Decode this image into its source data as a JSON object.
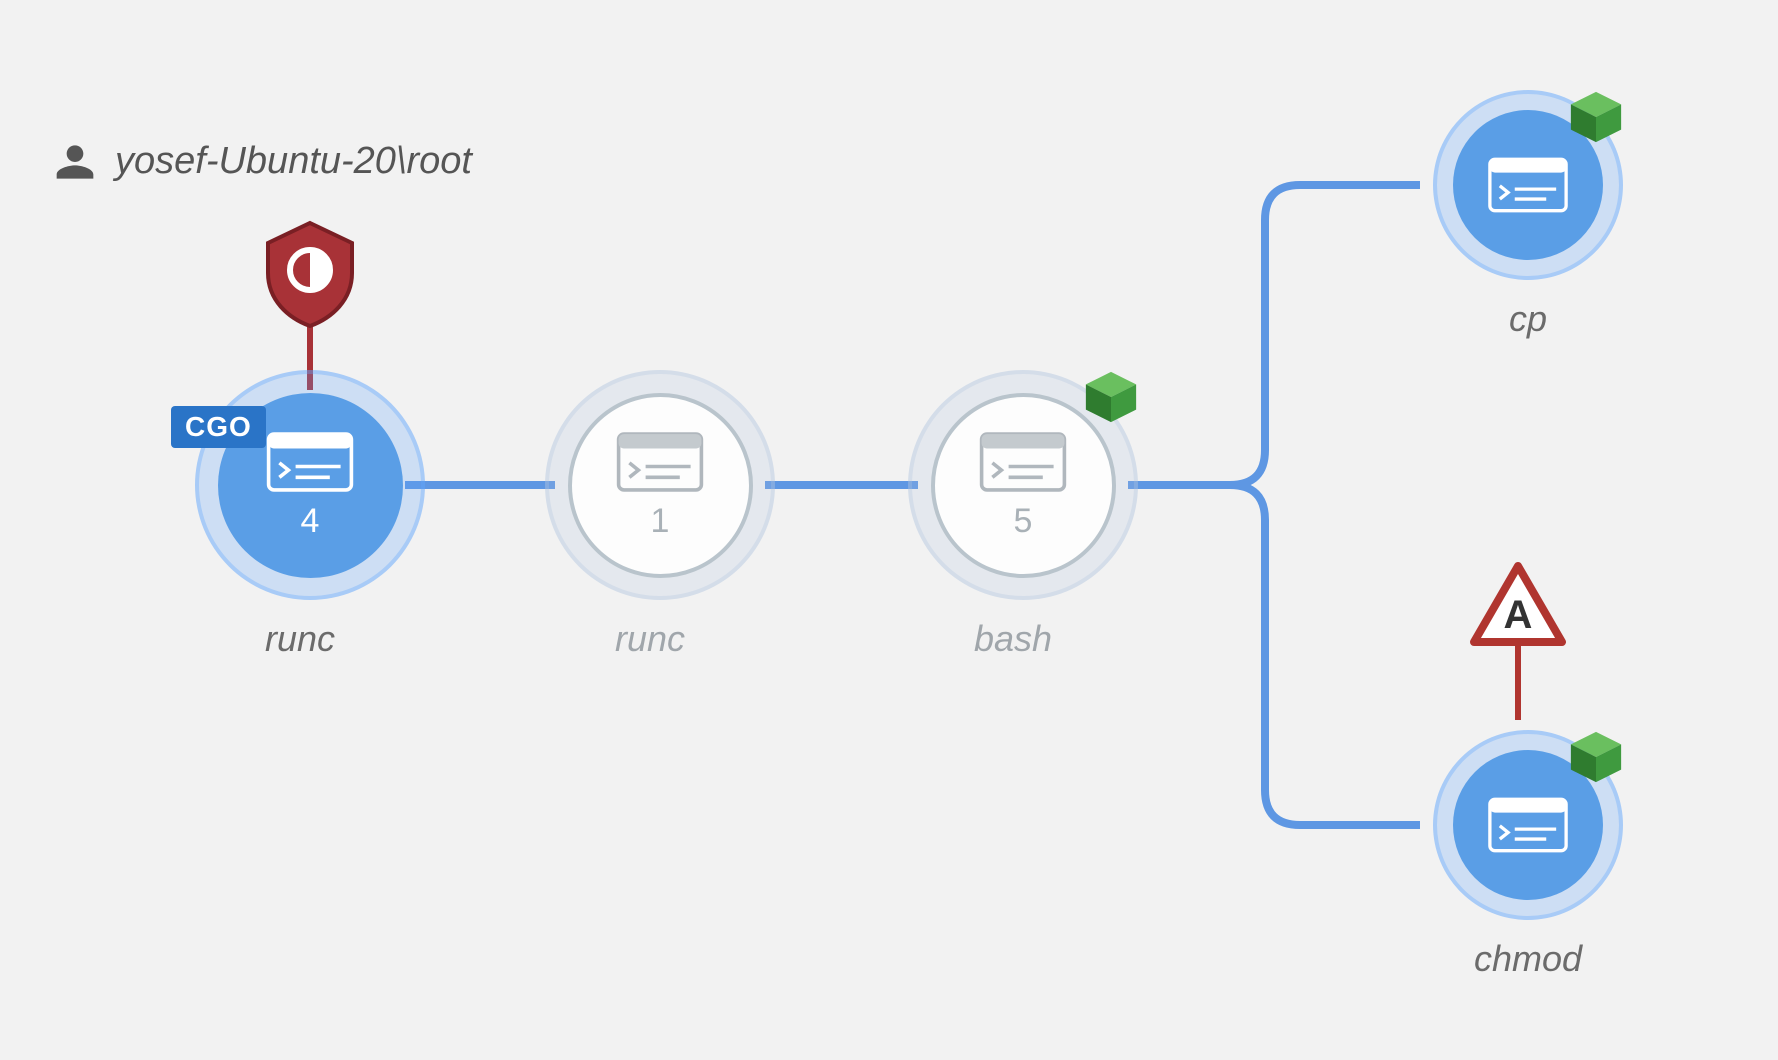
{
  "user_label": "yosef-Ubuntu-20\\root",
  "nodes": {
    "n1": {
      "name": "runc",
      "count": "4",
      "tag": "CGO"
    },
    "n2": {
      "name": "runc",
      "count": "1"
    },
    "n3": {
      "name": "bash",
      "count": "5"
    },
    "n4": {
      "name": "cp"
    },
    "n5": {
      "name": "chmod"
    }
  },
  "badges": {
    "shield_on": "n1",
    "warning_on": "n5",
    "warning_text": "A",
    "container_cube_on": [
      "n3",
      "n4",
      "n5"
    ]
  },
  "colors": {
    "edge": "#5e97e3",
    "blue_fill": "#5a9ee6",
    "gray_stroke": "#b9c4cc",
    "shield": "#a83237",
    "cube": "#3f8f3f",
    "warning": "#b0352f"
  }
}
